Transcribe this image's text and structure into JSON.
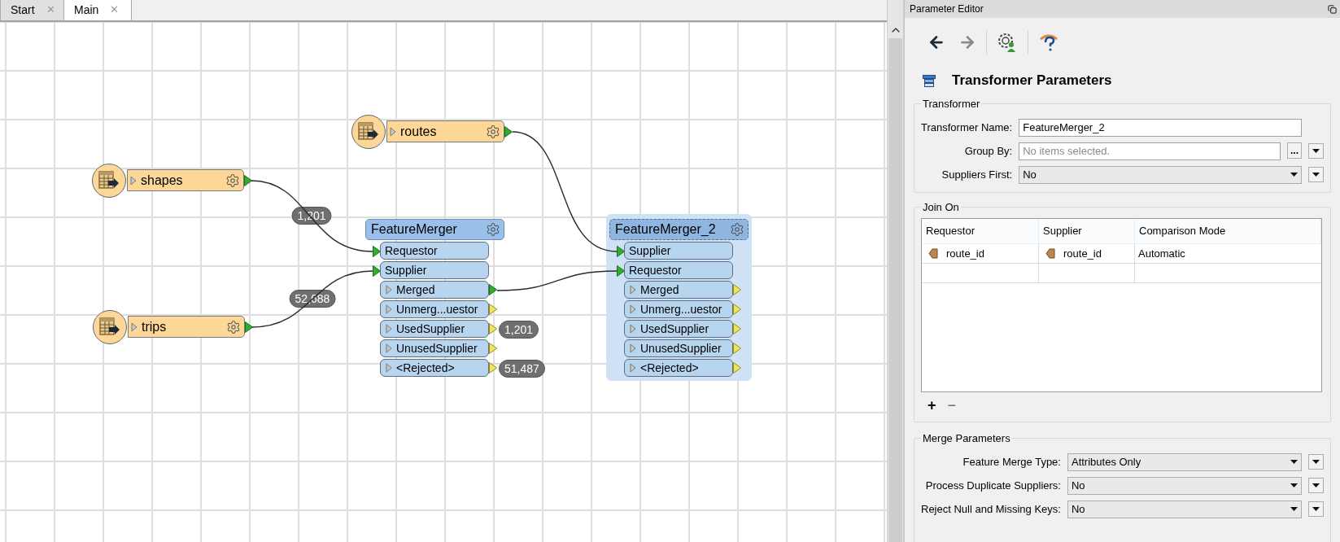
{
  "tabs": [
    {
      "label": "Start",
      "selected": false,
      "close": "✕"
    },
    {
      "label": "Main",
      "selected": true,
      "close": "✕"
    }
  ],
  "canvas": {
    "readers": [
      {
        "name": "routes"
      },
      {
        "name": "shapes",
        "count": "1,201"
      },
      {
        "name": "trips",
        "count": "52,688"
      }
    ],
    "transformers": [
      {
        "name": "FeatureMerger",
        "selected": false,
        "inputs": [
          "Requestor",
          "Supplier"
        ],
        "outputs": [
          {
            "label": "Merged",
            "connected": true
          },
          {
            "label": "Unmerg...uestor",
            "connected": false
          },
          {
            "label": "UsedSupplier",
            "connected": false,
            "count": "1,201"
          },
          {
            "label": "UnusedSupplier",
            "connected": false
          },
          {
            "label": "<Rejected>",
            "connected": false,
            "count": "51,487"
          }
        ]
      },
      {
        "name": "FeatureMerger_2",
        "selected": true,
        "inputs": [
          "Supplier",
          "Requestor"
        ],
        "outputs": [
          {
            "label": "Merged",
            "connected": false
          },
          {
            "label": "Unmerg...uestor",
            "connected": false
          },
          {
            "label": "UsedSupplier",
            "connected": false
          },
          {
            "label": "UnusedSupplier",
            "connected": false
          },
          {
            "label": "<Rejected>",
            "connected": false
          }
        ]
      }
    ]
  },
  "panel": {
    "title": "Parameter Editor",
    "toolbar": [
      {
        "kind": "back",
        "disabled": false
      },
      {
        "kind": "forward",
        "disabled": true
      },
      {
        "kind": "settings",
        "disabled": false
      },
      {
        "kind": "help",
        "disabled": false
      }
    ],
    "heading": "Transformer Parameters",
    "transformer_group": {
      "title": "Transformer",
      "fields": [
        {
          "kind": "text",
          "label": "Transformer Name:",
          "value": "FeatureMerger_2",
          "options_button": false
        },
        {
          "kind": "picker",
          "label": "Group By:",
          "placeholder": "No items selected.",
          "button": "...",
          "options_button": true
        },
        {
          "kind": "select",
          "label": "Suppliers First:",
          "value": "No",
          "options_button": true
        }
      ]
    },
    "join_group": {
      "title": "Join On",
      "columns": [
        "Requestor",
        "Supplier",
        "Comparison Mode"
      ],
      "rows": [
        {
          "requestor": "route_id",
          "supplier": "route_id",
          "mode": "Automatic"
        }
      ],
      "buttons": [
        "+",
        "−"
      ]
    },
    "merge_group": {
      "title": "Merge Parameters",
      "fields": [
        {
          "kind": "select",
          "label": "Feature Merge Type:",
          "value": "Attributes Only",
          "options_button": true
        },
        {
          "kind": "select",
          "label": "Process Duplicate Suppliers:",
          "value": "No",
          "options_button": true
        },
        {
          "kind": "select",
          "label": "Reject Null and Missing Keys:",
          "value": "No",
          "options_button": true
        }
      ]
    }
  }
}
